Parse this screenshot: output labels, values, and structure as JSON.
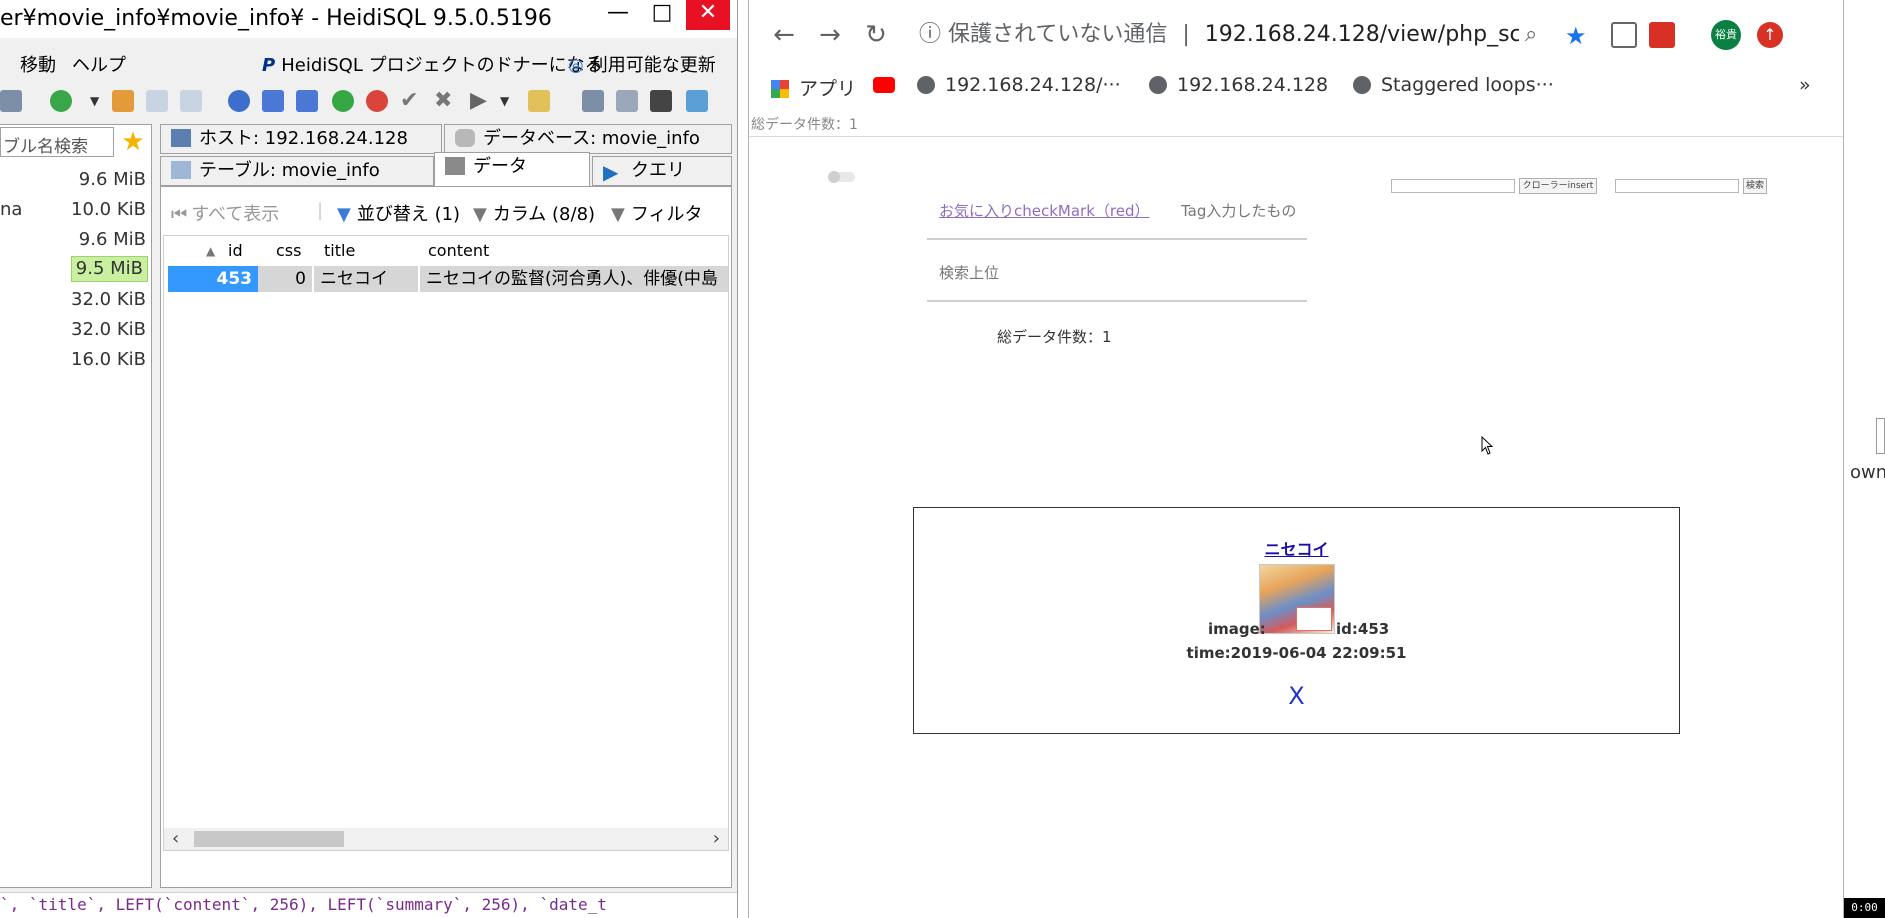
{
  "heidi": {
    "title": "er¥movie_info¥movie_info¥ - HeidiSQL 9.5.0.5196",
    "menu": {
      "go": "移動",
      "help": "ヘルプ",
      "donate": "HeidiSQL プロジェクトのドナーになる",
      "update": "利用可能な更新"
    },
    "search_placeholder": "ブル名検索",
    "sizes": [
      {
        "name": "",
        "value": "9.6 MiB"
      },
      {
        "name": "na",
        "value": "10.0 KiB"
      },
      {
        "name": "",
        "value": "9.6 MiB"
      },
      {
        "name": "",
        "value": "9.5 MiB"
      },
      {
        "name": "",
        "value": "32.0 KiB"
      },
      {
        "name": "",
        "value": "32.0 KiB"
      },
      {
        "name": "",
        "value": "16.0 KiB"
      }
    ],
    "tabs": {
      "host": "ホスト: 192.168.24.128",
      "database": "データベース: movie_info",
      "table": "テーブル: movie_info",
      "data": "データ",
      "query": "クエリ"
    },
    "filterbar": {
      "show_all": "すべて表示",
      "sort": "並び替え (1)",
      "columns": "カラム (8/8)",
      "filter": "フィルタ"
    },
    "grid": {
      "headers": [
        "id",
        "css",
        "title",
        "content"
      ],
      "row": {
        "id": "453",
        "css": "0",
        "title": "ニセコイ",
        "content": "ニセコイの監督(河合勇人)、俳優(中島"
      }
    },
    "sql": "`, `title`, LEFT(`content`, 256), LEFT(`summary`, 256), `date_t"
  },
  "chrome": {
    "nav": {
      "back": "←",
      "forward": "→",
      "reload": "↻"
    },
    "omnibox": {
      "security": "保護されていない通信",
      "url": "192.168.24.128/view/php_sc···"
    },
    "avatar": "裕貴",
    "bookmarks": {
      "apps": "アプリ",
      "b1": "192.168.24.128/···",
      "b2": "192.168.24.128",
      "b3": "Staggered loops···",
      "more": "»"
    },
    "page": {
      "total_top": "総データ件数：1",
      "crawler_btn": "クローラーinsert",
      "search_btn": "検索",
      "fav_link": "お気に入りcheckMark（red）",
      "tag_text": "Tag入力したもの",
      "search_top": "検索上位",
      "total_mid": "総データ件数：1",
      "card": {
        "title": "ニセコイ",
        "image_label": "image:",
        "id_label": "id:453",
        "time_label": "time:2019-06-04 22:09:51",
        "delete": "X"
      }
    }
  },
  "side": {
    "partial": "own",
    "clock": "0:00"
  },
  "colors": {
    "selected_row": "#3399ff",
    "size_highlight": "#c8f0a0",
    "link": "#1a0dab",
    "visited": "#8e6fbf"
  }
}
